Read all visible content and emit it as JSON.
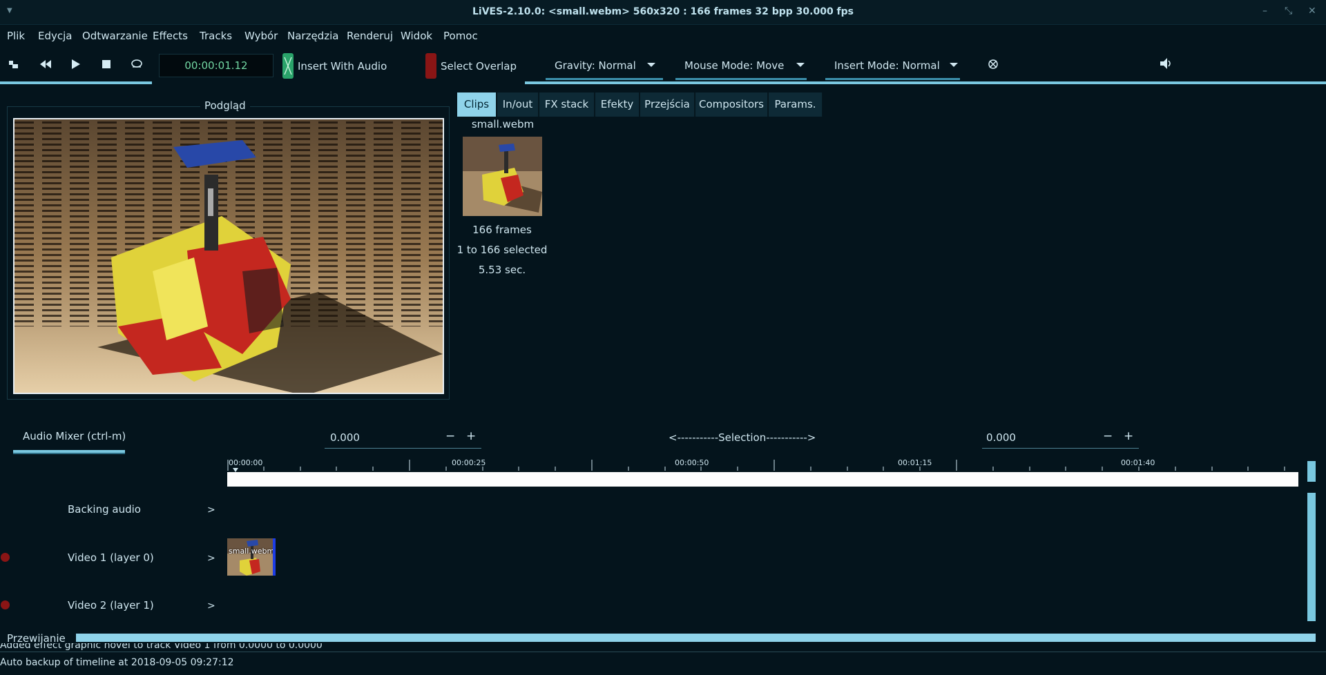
{
  "window": {
    "title": "LiVES-2.10.0: <small.webm> 560x320 : 166 frames 32 bpp 30.000 fps",
    "controls": [
      "minimize-icon",
      "maximize-icon",
      "close-icon"
    ]
  },
  "menu": [
    "Plik",
    "Edycja",
    "Odtwarzanie",
    "Effects",
    "Tracks",
    "Wybór",
    "Narzędzia",
    "Renderuj",
    "Widok",
    "Pomoc"
  ],
  "toolbar": {
    "icons": [
      "stop-rewind-icon",
      "rewind-icon",
      "play-icon",
      "stop-icon",
      "loop-icon"
    ],
    "timecode": "00:00:01.12",
    "insert_with_audio": "Insert With Audio",
    "select_overlap": "Select Overlap",
    "gravity": "Gravity: Normal",
    "mouse_mode": "Mouse Mode: Move",
    "insert_mode": "Insert Mode: Normal",
    "colors": {
      "accent": "#7ac8e0",
      "toggle_on": "#2aa36a",
      "toggle_off": "#8a1515"
    }
  },
  "preview": {
    "title": "Podgląd"
  },
  "tabs": [
    "Clips",
    "In/out",
    "FX stack",
    "Efekty",
    "Przejścia",
    "Compositors",
    "Params."
  ],
  "active_tab": "Clips",
  "clip": {
    "name": "small.webm",
    "frames": "166 frames",
    "selected": "1 to 166 selected",
    "duration": "5.53 sec."
  },
  "mixer": {
    "label": "Audio Mixer (ctrl-m)",
    "start_value": "0.000",
    "end_value": "0.000",
    "selection_label": "<-----------Selection----------->",
    "minus": "−",
    "plus": "+"
  },
  "ruler": {
    "labels": [
      "00:00:00",
      "00:00:25",
      "00:00:50",
      "00:01:15",
      "00:01:40"
    ]
  },
  "tracks": [
    {
      "label": "Backing audio",
      "expander": ">"
    },
    {
      "label": "Video 1 (layer 0)",
      "expander": ">"
    },
    {
      "label": "Video 2 (layer 1)",
      "expander": ">"
    }
  ],
  "timeline_block": {
    "label": "small.webm"
  },
  "bottom": {
    "playback_label": "Przewijanie",
    "status_1": "Added effect graphic novel to track Video 1 from 0.0000 to 0.0000",
    "status_2": "Auto backup of timeline at 2018-09-05    09:27:12"
  }
}
